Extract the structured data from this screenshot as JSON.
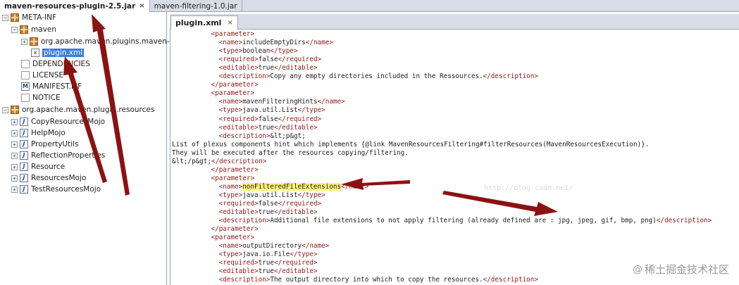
{
  "jar_tabs": [
    {
      "label": "maven-resources-plugin-2.5.jar",
      "close": "×"
    },
    {
      "label": "maven-filtering-1.0.jar"
    }
  ],
  "tree": {
    "meta_inf": "META-INF",
    "maven": "maven",
    "plugin_pkg": "org.apache.maven.plugins.maven-res",
    "plugin_xml": "plugin.xml",
    "dependencies": "DEPENDENCIES",
    "license": "LICENSE",
    "manifest": "MANIFEST.MF",
    "notice": "NOTICE",
    "resources_pkg": "org.apache.maven.plugin.resources",
    "classes": [
      "CopyResourcesMojo",
      "HelpMojo",
      "PropertyUtils",
      "ReflectionProperties",
      "Resource",
      "ResourcesMojo",
      "TestResourcesMojo"
    ]
  },
  "editor": {
    "tab_label": "plugin.xml",
    "tab_close": "×",
    "lines": [
      {
        "i": 10,
        "t": "<parameter>"
      },
      {
        "i": 12,
        "t": "<name>includeEmptyDirs</name>"
      },
      {
        "i": 12,
        "t": "<type>boolean</type>"
      },
      {
        "i": 12,
        "t": "<required>false</required>"
      },
      {
        "i": 12,
        "t": "<editable>true</editable>"
      },
      {
        "i": 12,
        "t": "<description>Copy any empty directories included in the Ressources.</description>"
      },
      {
        "i": 10,
        "t": "</parameter>"
      },
      {
        "i": 10,
        "t": "<parameter>"
      },
      {
        "i": 12,
        "t": "<name>mavenFilteringHints</name>"
      },
      {
        "i": 12,
        "t": "<type>java.util.List</type>"
      },
      {
        "i": 12,
        "t": "<required>false</required>"
      },
      {
        "i": 12,
        "t": "<editable>true</editable>"
      },
      {
        "i": 12,
        "t": "<description>&lt;p&gt;"
      },
      {
        "i": 0,
        "t": "List of plexus components hint which implements {@link MavenResourcesFiltering#filterResources(MavenResourcesExecution)}."
      },
      {
        "i": 0,
        "t": "They will be executed after the resources copying/filtering."
      },
      {
        "i": 0,
        "t": "&lt;/p&gt;</description>"
      },
      {
        "i": 10,
        "t": "</parameter>"
      },
      {
        "i": 10,
        "t": "<parameter>"
      },
      {
        "i": 12,
        "t": "<name>nonFilteredFileExtensions</name>",
        "hl": "nonFilteredFileExtensions"
      },
      {
        "i": 12,
        "t": "<type>java.util.List</type>"
      },
      {
        "i": 12,
        "t": "<required>false</required>"
      },
      {
        "i": 12,
        "t": "<editable>true</editable>"
      },
      {
        "i": 12,
        "t": "<description>Additional file extensions to not apply filtering (already defined are : jpg, jpeg, gif, bmp, png)</description>"
      },
      {
        "i": 10,
        "t": "</parameter>"
      },
      {
        "i": 10,
        "t": "<parameter>"
      },
      {
        "i": 12,
        "t": "<name>outputDirectory</name>"
      },
      {
        "i": 12,
        "t": "<type>java.io.File</type>"
      },
      {
        "i": 12,
        "t": "<required>true</required>"
      },
      {
        "i": 12,
        "t": "<editable>true</editable>"
      },
      {
        "i": 12,
        "t": "<description>The output directory into which to copy the resources.</description>"
      }
    ],
    "watermark": "http://blog.csdn.net/"
  },
  "brand": {
    "at": "@",
    "text": "稀土掘金技术社区"
  },
  "colors": {
    "arrow": "#8b1212",
    "highlight": "#fff27a",
    "selection": "#3d7fd6",
    "tag": "#8b1a1a"
  }
}
